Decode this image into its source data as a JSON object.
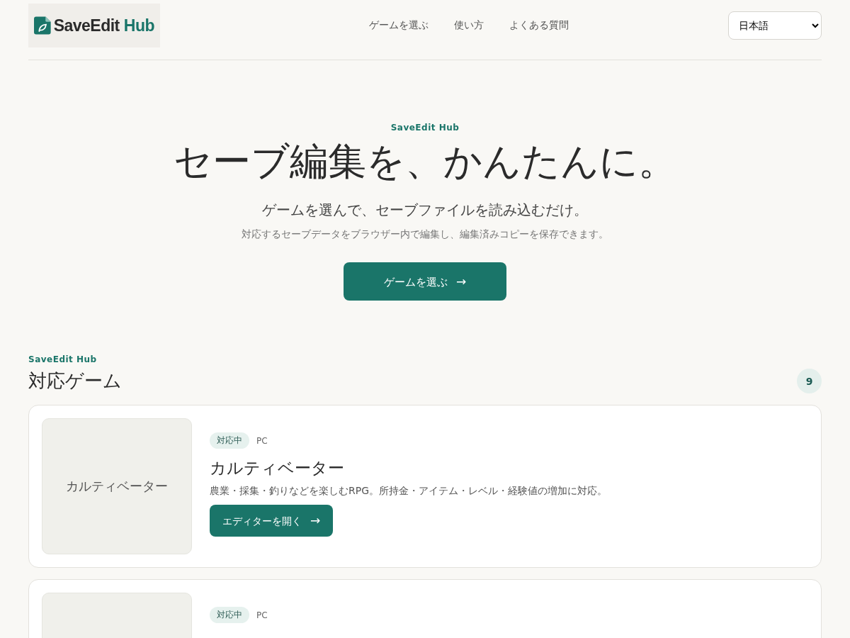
{
  "header": {
    "logo": {
      "name": "SaveEdit",
      "accent": "Hub"
    },
    "nav": [
      "ゲームを選ぶ",
      "使い方",
      "よくある質問"
    ],
    "language": "日本語"
  },
  "hero": {
    "eyebrow": "SaveEdit Hub",
    "title": "セーブ編集を、かんたんに。",
    "subtitle": "ゲームを選んで、セーブファイルを読み込むだけ。",
    "description": "対応するセーブデータをブラウザー内で編集し、編集済みコピーを保存できます。",
    "cta": {
      "label": "ゲームを選ぶ",
      "icon": "→"
    }
  },
  "games_section": {
    "eyebrow": "SaveEdit Hub",
    "title": "対応ゲーム",
    "count": "9",
    "games": [
      {
        "thumbnail": "カルティベーター",
        "status": "対応中",
        "platform": "PC",
        "title": "カルティベーター",
        "description": "農業・採集・釣りなどを楽しむRPG。所持金・アイテム・レベル・経験値の増加に対応。",
        "button": {
          "label": "エディターを開く",
          "icon": "→"
        }
      },
      {
        "status": "対応中",
        "platform": "PC"
      }
    ]
  }
}
